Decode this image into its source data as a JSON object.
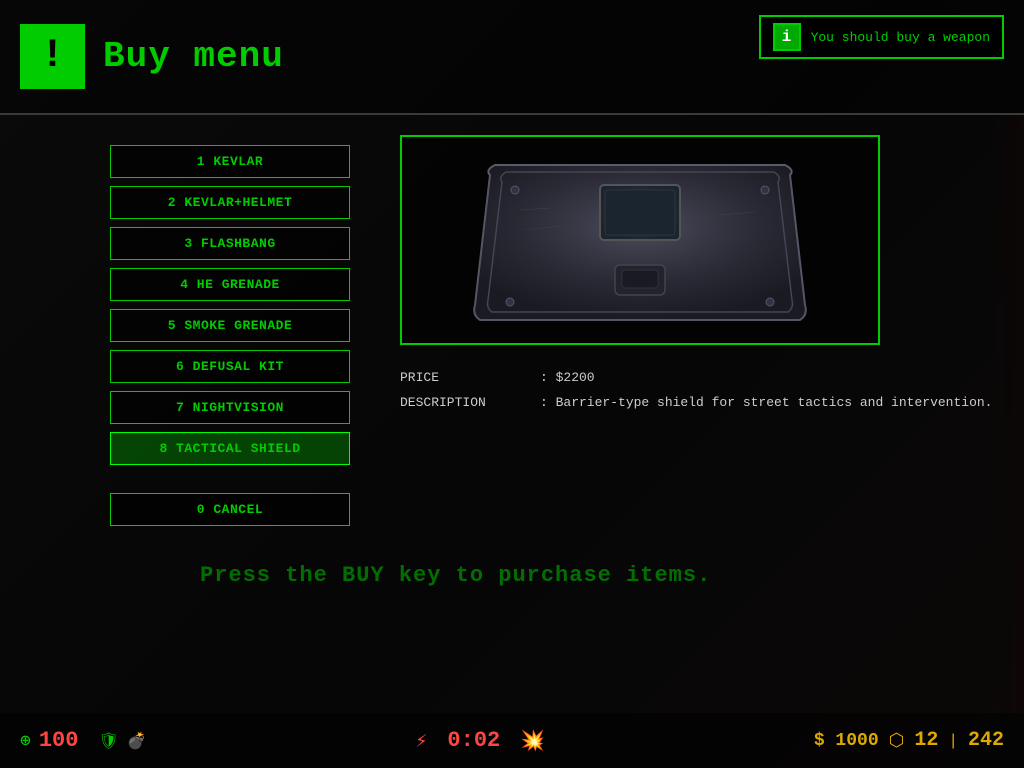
{
  "header": {
    "icon_symbol": "!",
    "title": "Buy menu"
  },
  "notification": {
    "icon": "i",
    "text": "You should buy a weapon"
  },
  "menu": {
    "items": [
      {
        "id": "1",
        "label": "1 KEVLAR",
        "selected": false
      },
      {
        "id": "2",
        "label": "2 KEVLAR+HELMET",
        "selected": false
      },
      {
        "id": "3",
        "label": "3 FLASHBANG",
        "selected": false
      },
      {
        "id": "4",
        "label": "4 HE GRENADE",
        "selected": false
      },
      {
        "id": "5",
        "label": "5 SMOKE GRENADE",
        "selected": false
      },
      {
        "id": "6",
        "label": "6 DEFUSAL KIT",
        "selected": false
      },
      {
        "id": "7",
        "label": "7 NIGHTVISION",
        "selected": false
      },
      {
        "id": "8",
        "label": "8 TACTICAL SHIELD",
        "selected": true
      },
      {
        "id": "0",
        "label": "0 CANCEL",
        "selected": false
      }
    ]
  },
  "detail": {
    "price_label": "PRICE",
    "price_value": ": $2200",
    "description_label": "DESCRIPTION",
    "description_value": ": Barrier-type shield for street tactics and intervention."
  },
  "press_buy": "Press the BUY key to purchase items.",
  "hud": {
    "health": "100",
    "timer": "0:02",
    "money": "$ 1000",
    "ammo_main": "12",
    "ammo_reserve": "242"
  }
}
